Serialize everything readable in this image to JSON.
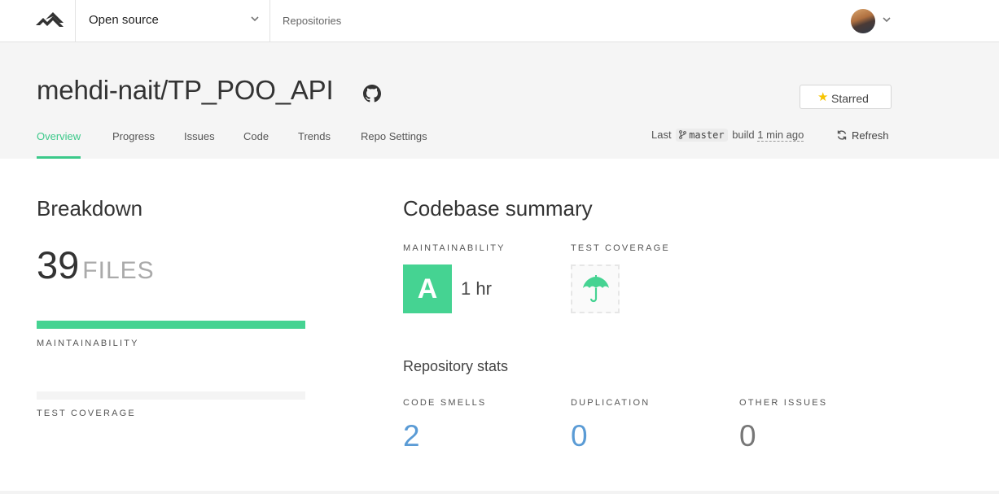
{
  "topbar": {
    "org_label": "Open source",
    "repositories_link": "Repositories"
  },
  "header": {
    "repo_title": "mehdi-nait/TP_POO_API",
    "star_label": "Starred",
    "tabs": [
      {
        "label": "Overview",
        "active": true
      },
      {
        "label": "Progress",
        "active": false
      },
      {
        "label": "Issues",
        "active": false
      },
      {
        "label": "Code",
        "active": false
      },
      {
        "label": "Trends",
        "active": false
      },
      {
        "label": "Repo Settings",
        "active": false
      }
    ],
    "build": {
      "prefix": "Last",
      "branch": "master",
      "middle": "build",
      "ago": "1 min ago"
    },
    "refresh_label": "Refresh"
  },
  "breakdown": {
    "title": "Breakdown",
    "file_count": "39",
    "file_word": "FILES",
    "maintainability_label": "MAINTAINABILITY",
    "maintainability_fraction": 1.0,
    "test_coverage_label": "TEST COVERAGE",
    "test_coverage_fraction": 0.0
  },
  "summary": {
    "title": "Codebase summary",
    "maintainability_label": "MAINTAINABILITY",
    "grade": "A",
    "tech_debt": "1 hr",
    "test_coverage_label": "TEST COVERAGE",
    "stats_title": "Repository stats",
    "stats": [
      {
        "label": "CODE SMELLS",
        "value": "2",
        "color": "#5a9bd5"
      },
      {
        "label": "DUPLICATION",
        "value": "0",
        "color": "#5a9bd5"
      },
      {
        "label": "OTHER ISSUES",
        "value": "0",
        "color": "#777777"
      }
    ]
  },
  "colors": {
    "accent": "#3cc98a",
    "grade_green": "#45d392",
    "star": "#f7c400"
  },
  "icons": [
    "codeclimate-logo-icon",
    "chevron-down-icon",
    "github-icon",
    "star-icon",
    "branch-icon",
    "refresh-icon",
    "umbrella-icon"
  ]
}
